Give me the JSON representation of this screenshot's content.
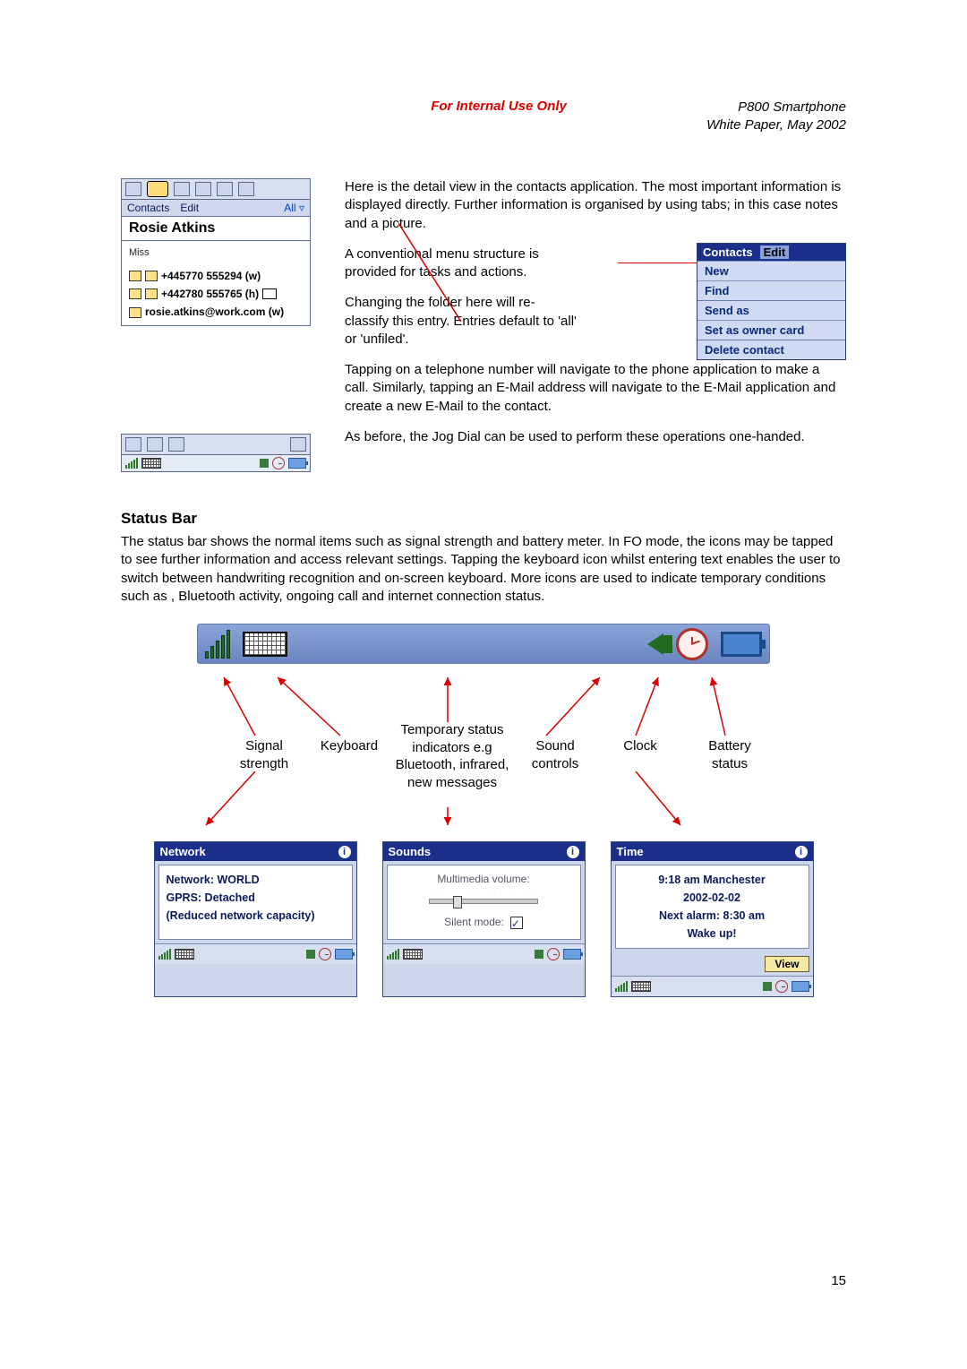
{
  "header": {
    "internal": "For Internal Use Only",
    "product": "P800 Smartphone",
    "doc": "White Paper, May 2002"
  },
  "contact_fig": {
    "menu1": "Contacts",
    "menu2": "Edit",
    "menu_right": "All ▿",
    "name": "Rosie Atkins",
    "title": "Miss",
    "phone_w": "+445770 555294 (w)",
    "phone_h": "+442780 555765 (h)",
    "email": "rosie.atkins@work.com (w)"
  },
  "top_text": {
    "p1": "Here is the detail view in the contacts application. The most important information is displayed directly. Further information is organised by using tabs; in this case notes and a picture.",
    "p2": "A conventional menu structure is provided for tasks and actions.",
    "p3": "Changing the folder here will re-classify this entry. Entries default to 'all' or 'unfiled'.",
    "p4": "Tapping on a telephone number will navigate to the phone application to make a call. Similarly, tapping an E-Mail address will navigate to the E-Mail application and create a new E-Mail to the contact.",
    "p5": "As before, the Jog Dial can be used to perform these operations one-handed."
  },
  "edit_menu": {
    "head1": "Contacts",
    "head2": "Edit",
    "items": [
      "New",
      "Find",
      "Send as",
      "Set as owner card",
      "Delete contact"
    ]
  },
  "status_section": {
    "title": "Status Bar",
    "para": "The status bar shows the normal items such as signal strength and battery meter. In FO mode, the icons may be tapped to see further information and access relevant settings. Tapping the keyboard icon whilst entering text enables the user to switch between handwriting recognition and on-screen keyboard. More icons are used to indicate temporary conditions such as , Bluetooth activity, ongoing call and internet connection status."
  },
  "labels": {
    "signal": "Signal strength",
    "keyboard": "Keyboard",
    "temp": "Temporary status indicators e.g Bluetooth, infrared, new messages",
    "sound": "Sound controls",
    "clock": "Clock",
    "battery": "Battery status"
  },
  "popups": {
    "network": {
      "title": "Network",
      "line1": "Network: WORLD",
      "line2": "GPRS: Detached",
      "line3": "(Reduced network capacity)"
    },
    "sounds": {
      "title": "Sounds",
      "vol_label": "Multimedia volume:",
      "silent_label": "Silent mode:"
    },
    "time": {
      "title": "Time",
      "line1": "9:18 am  Manchester",
      "line2": "2002-02-02",
      "line3": "Next alarm: 8:30 am",
      "line4": "Wake up!",
      "view": "View"
    }
  },
  "page_number": "15"
}
